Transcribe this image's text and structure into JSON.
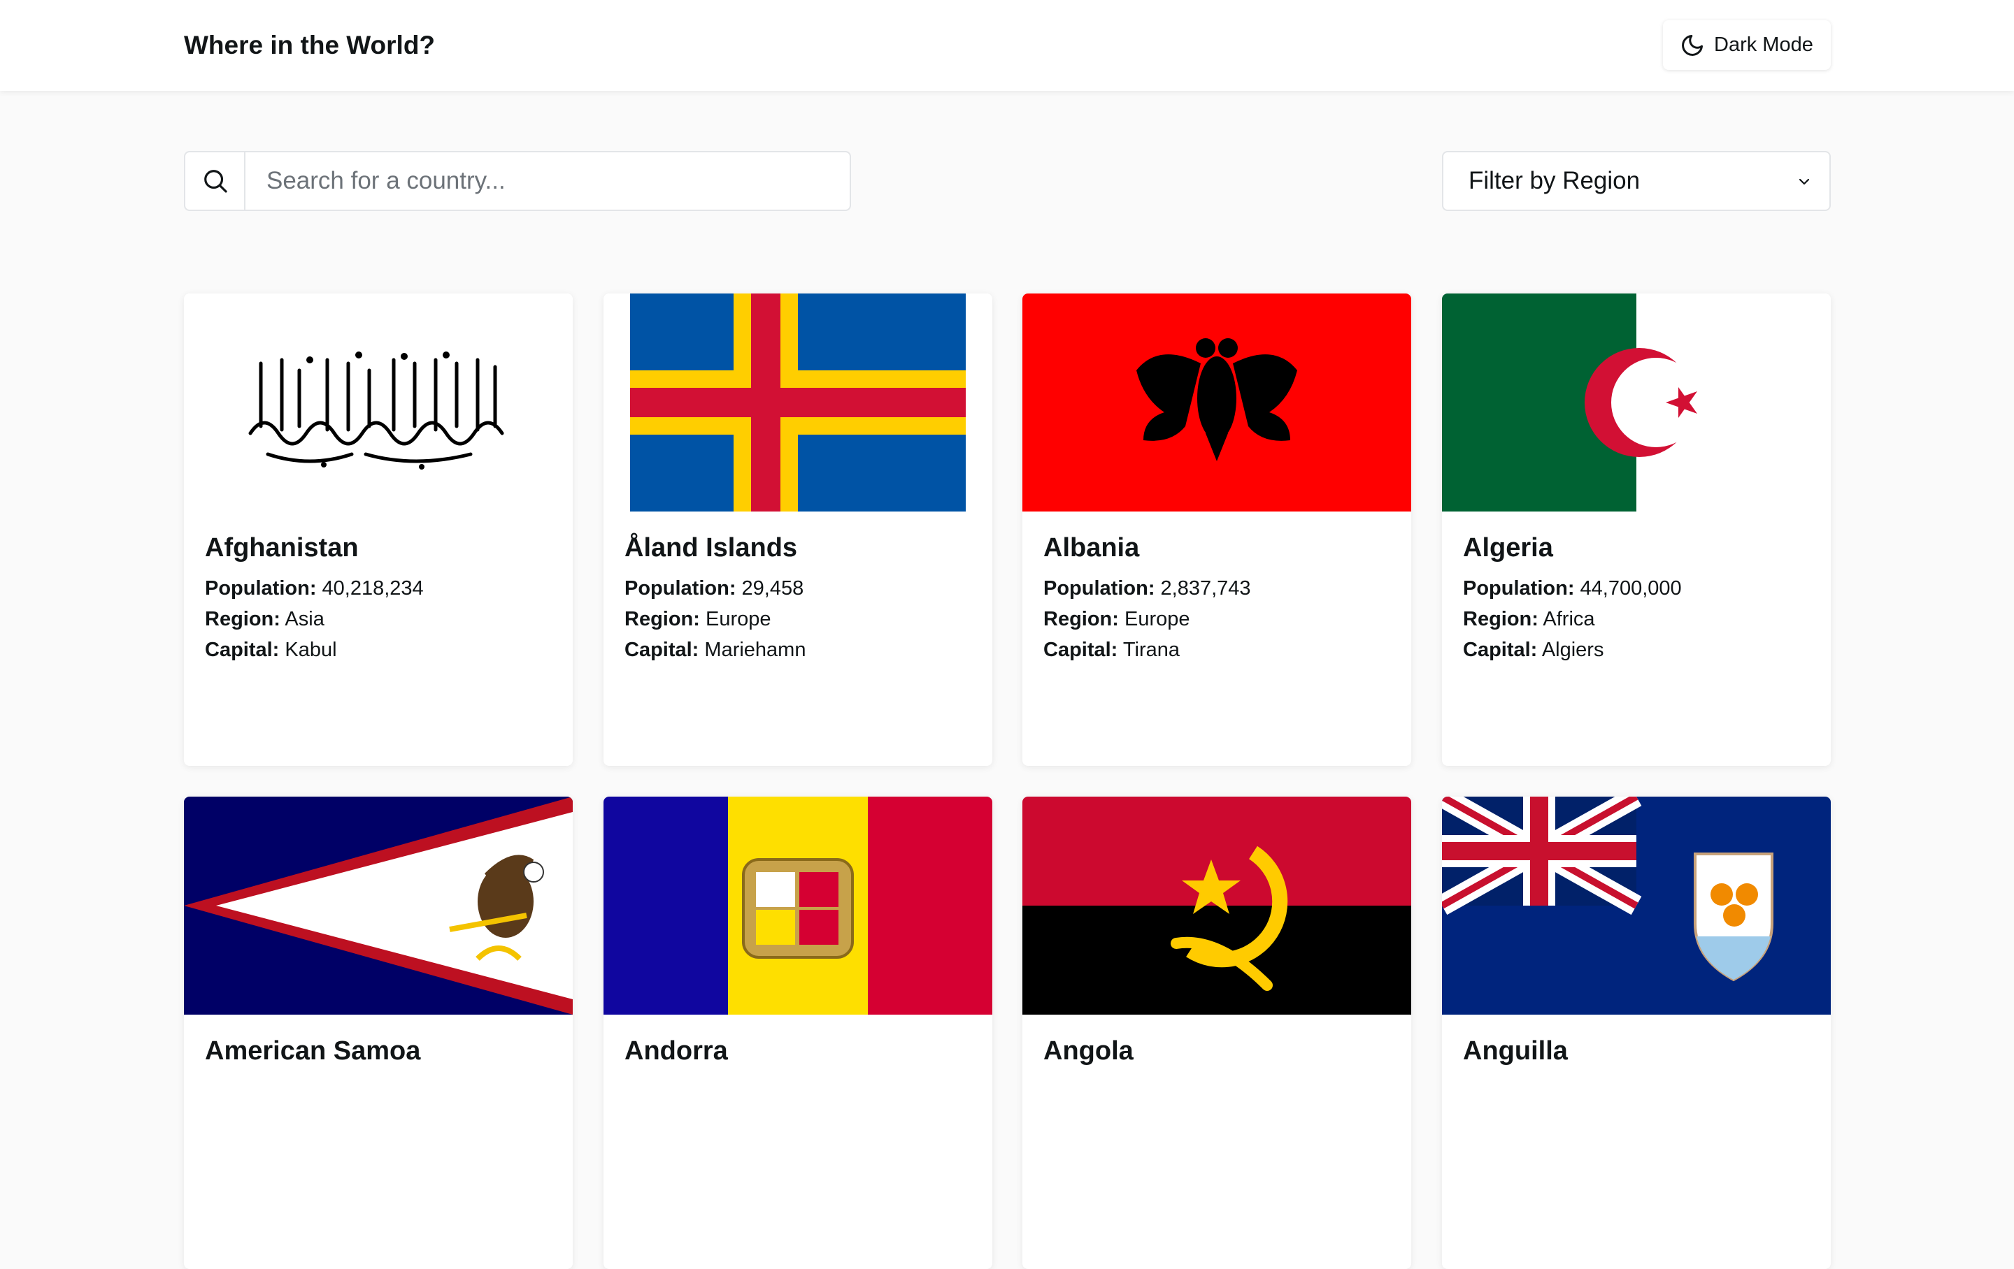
{
  "header": {
    "title": "Where in the World?",
    "theme_toggle_label": "Dark Mode"
  },
  "search": {
    "placeholder": "Search for a country...",
    "value": ""
  },
  "filter": {
    "label": "Filter by Region"
  },
  "labels": {
    "population": "Population:",
    "region": "Region:",
    "capital": "Capital:"
  },
  "countries": [
    {
      "name": "Afghanistan",
      "population": "40,218,234",
      "region": "Asia",
      "capital": "Kabul",
      "flag_icon": "afghanistan-flag"
    },
    {
      "name": "Åland Islands",
      "population": "29,458",
      "region": "Europe",
      "capital": "Mariehamn",
      "flag_icon": "aland-islands-flag"
    },
    {
      "name": "Albania",
      "population": "2,837,743",
      "region": "Europe",
      "capital": "Tirana",
      "flag_icon": "albania-flag"
    },
    {
      "name": "Algeria",
      "population": "44,700,000",
      "region": "Africa",
      "capital": "Algiers",
      "flag_icon": "algeria-flag"
    },
    {
      "name": "American Samoa",
      "flag_icon": "american-samoa-flag"
    },
    {
      "name": "Andorra",
      "flag_icon": "andorra-flag"
    },
    {
      "name": "Angola",
      "flag_icon": "angola-flag"
    },
    {
      "name": "Anguilla",
      "flag_icon": "anguilla-flag"
    }
  ],
  "colors": {
    "background": "#fafafa",
    "surface": "#ffffff",
    "text": "#111517",
    "placeholder": "#6c7278"
  }
}
